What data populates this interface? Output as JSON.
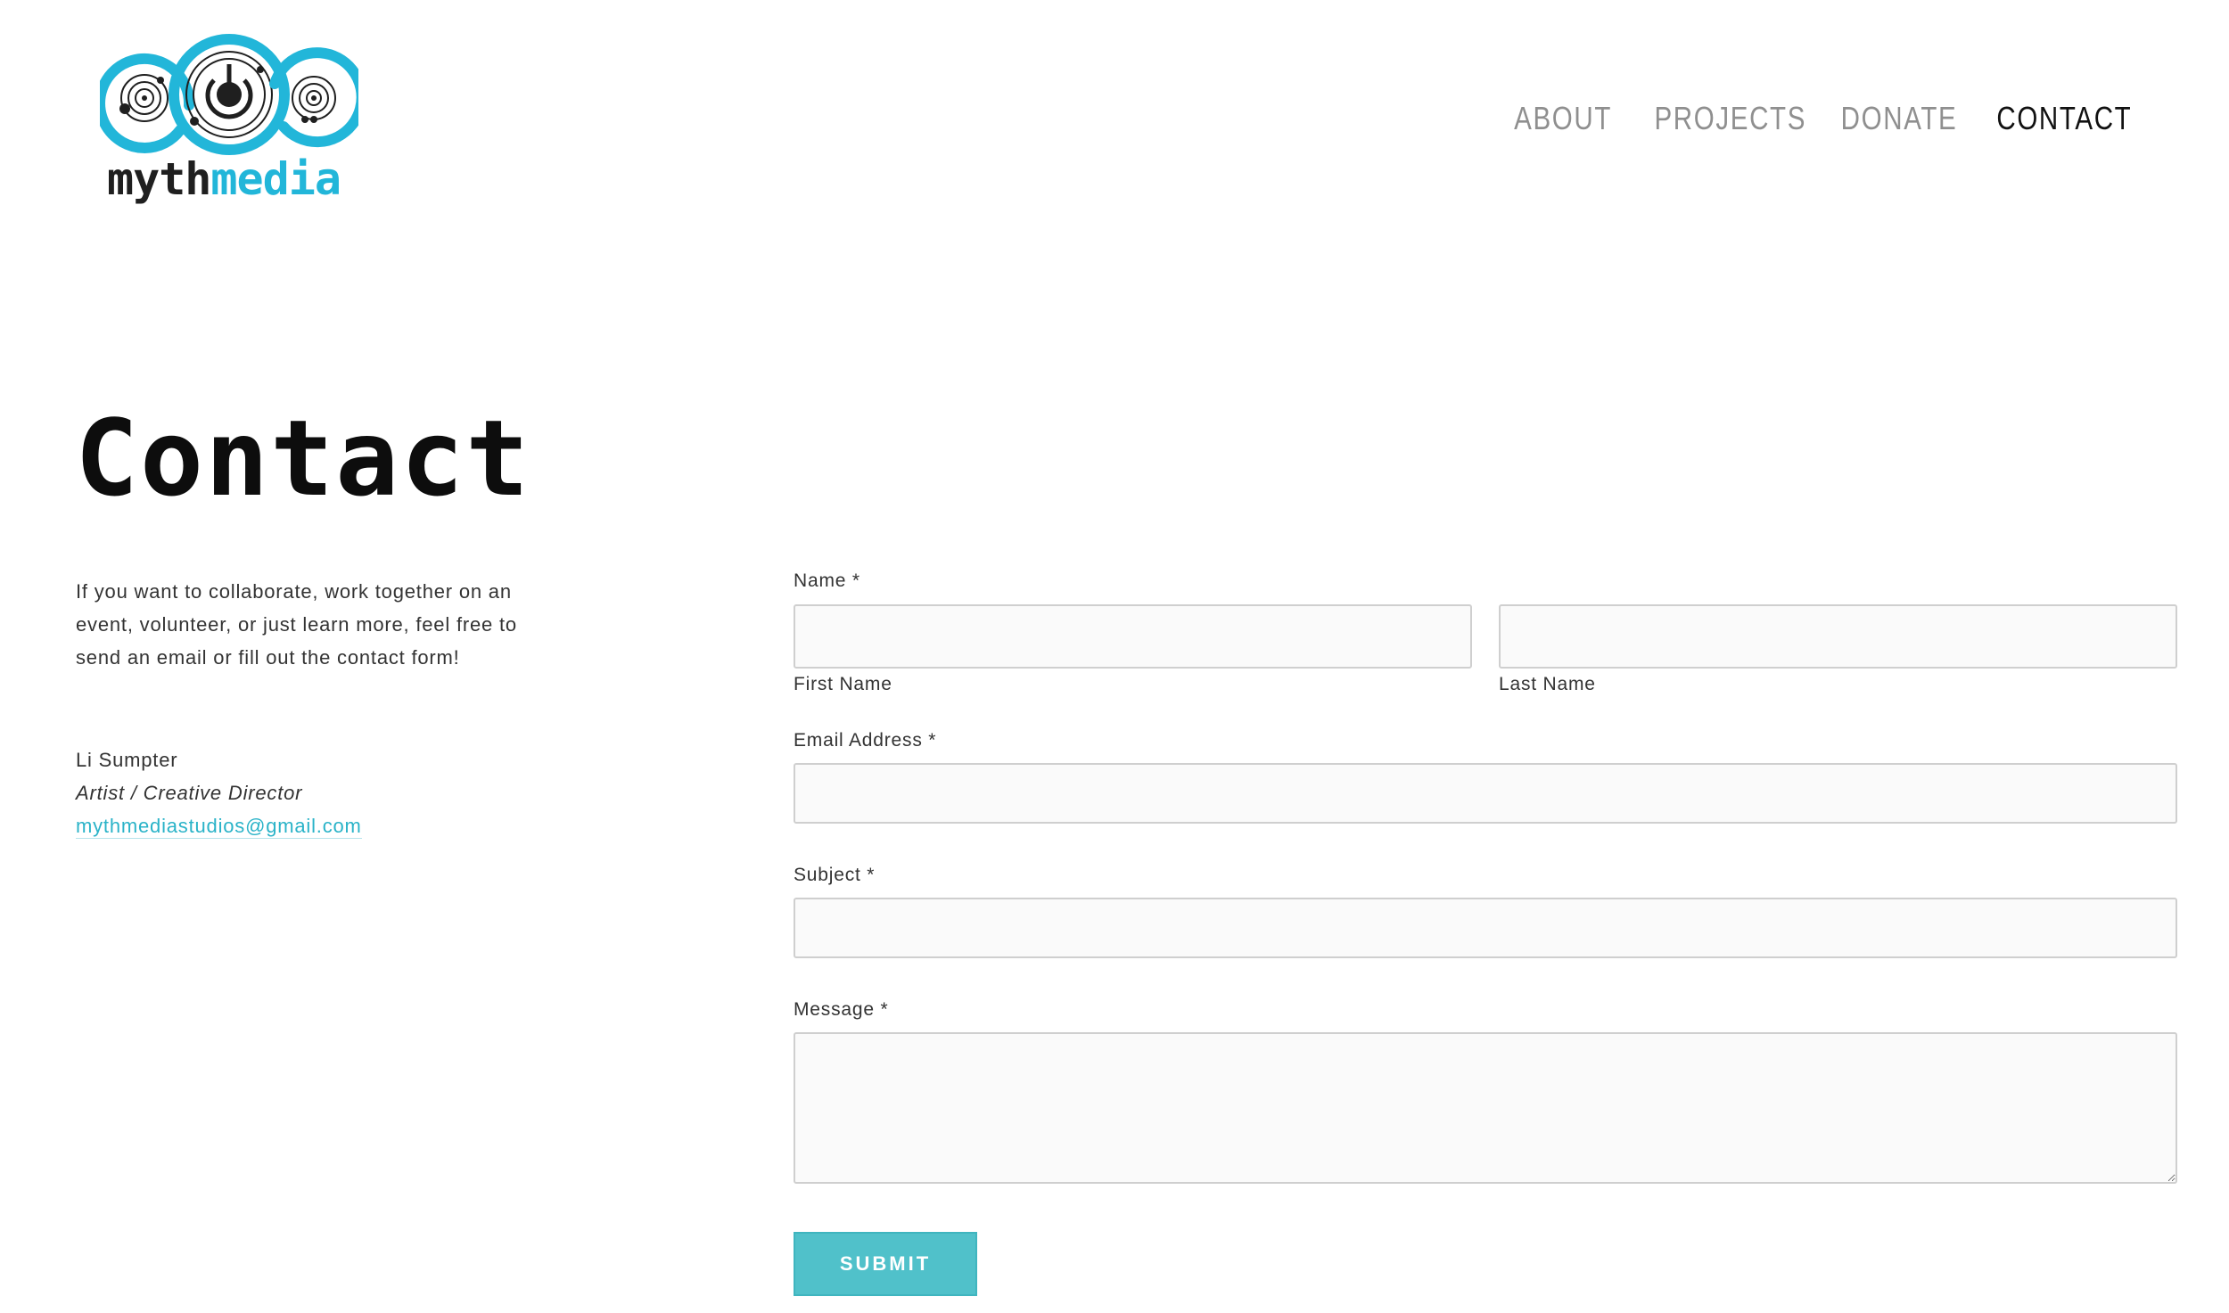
{
  "brand": {
    "logo_text_myth": "myth",
    "logo_text_media": "media",
    "colors": {
      "accent": "#22b6d9",
      "dark": "#1f1f1f",
      "button": "#50c1ca",
      "link": "#2ab3c8"
    }
  },
  "nav": {
    "items": [
      {
        "label": "ABOUT"
      },
      {
        "label": "PROJECTS"
      },
      {
        "label": "DONATE"
      },
      {
        "label": "CONTACT",
        "active": true
      }
    ]
  },
  "page": {
    "title": "Contact",
    "intro": "If you want to collaborate, work together on an event, volunteer, or just learn more, feel free to send an email or fill out the contact form!"
  },
  "contact": {
    "name": "Li Sumpter",
    "role": "Artist / Creative Director",
    "email": "mythmediastudios@gmail.com"
  },
  "form": {
    "name_label": "Name *",
    "first_name_sublabel": "First Name",
    "last_name_sublabel": "Last Name",
    "email_label": "Email Address *",
    "subject_label": "Subject *",
    "message_label": "Message *",
    "first_name_value": "",
    "last_name_value": "",
    "email_value": "",
    "subject_value": "",
    "message_value": "",
    "submit_label": "SUBMIT"
  }
}
